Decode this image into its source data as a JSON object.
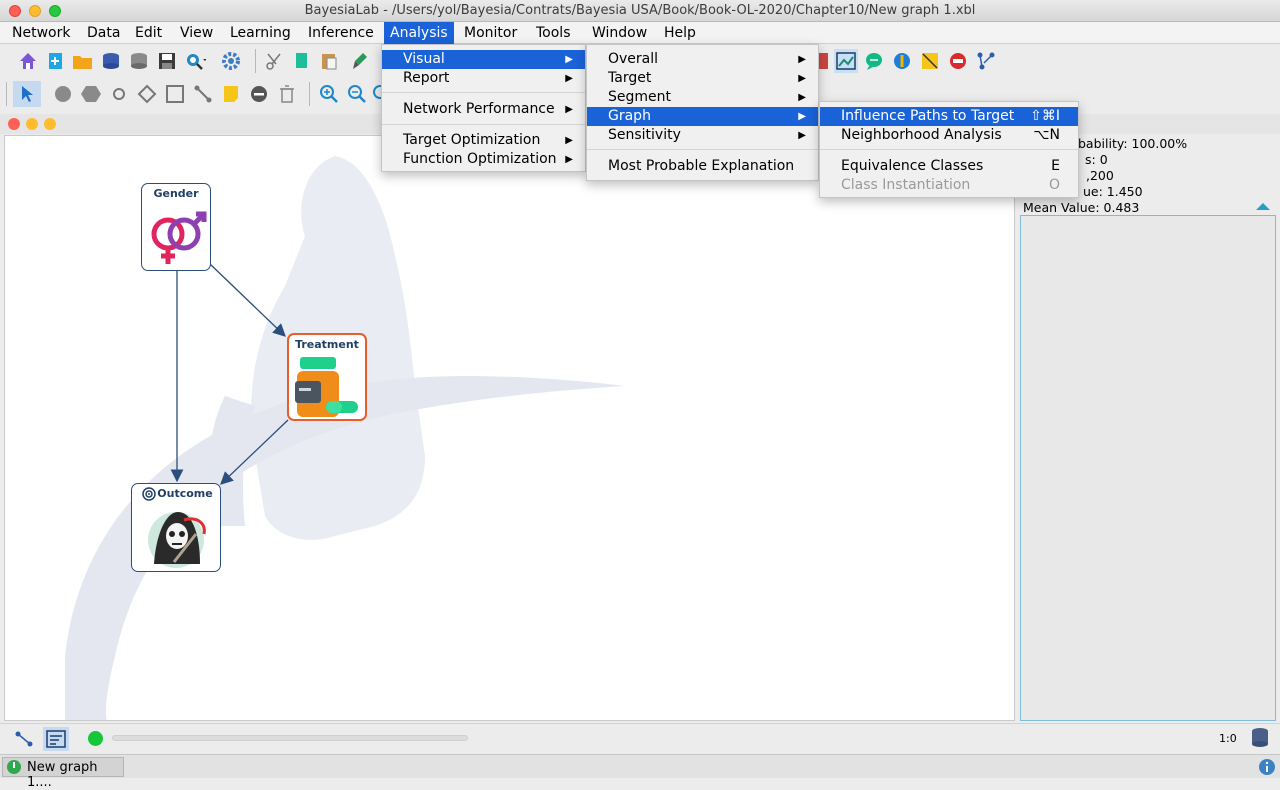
{
  "window": {
    "title": "BayesiaLab - /Users/yol/Bayesia/Contrats/Bayesia USA/Book/Book-OL-2020/Chapter10/New graph 1.xbl"
  },
  "menubar": [
    "Network",
    "Data",
    "Edit",
    "View",
    "Learning",
    "Inference",
    "Analysis",
    "Monitor",
    "Tools",
    "Window",
    "Help"
  ],
  "menus": {
    "analysis": {
      "visual": "Visual",
      "report": "Report",
      "network_performance": "Network Performance",
      "target_optimization": "Target Optimization",
      "function_optimization": "Function Optimization"
    },
    "visual": {
      "overall": "Overall",
      "target": "Target",
      "segment": "Segment",
      "graph": "Graph",
      "sensitivity": "Sensitivity",
      "mpe": "Most Probable Explanation"
    },
    "graph": {
      "influence_paths": "Influence Paths to Target",
      "influence_paths_shortcut": "⇧⌘I",
      "neighborhood": "Neighborhood Analysis",
      "neighborhood_shortcut": "⌥N",
      "equivalence": "Equivalence Classes",
      "equivalence_shortcut": "E",
      "class_instantiation": "Class Instantiation",
      "class_instantiation_shortcut": "O"
    }
  },
  "nodes": {
    "gender": "Gender",
    "treatment": "Treatment",
    "outcome": "Outcome"
  },
  "right_panel": {
    "line1": "bability: 100.00%",
    "line2": "s: 0",
    "line3": ",200",
    "line4": "ue: 1.450",
    "line5": "Mean Value: 0.483"
  },
  "statusbar": {
    "ratio": "1:0"
  },
  "taskbar": {
    "window_label": "New graph 1...."
  },
  "colors": {
    "accent": "#1a62d8",
    "node_border": "#2b4f7c",
    "arrow": "#2b4f7c"
  },
  "icons": [
    "home-icon",
    "new-network-icon",
    "open-folder-icon",
    "database-icon",
    "save-icon",
    "zoom-search-icon",
    "gear-icon",
    "scissors-icon",
    "copy-icon",
    "paste-icon",
    "brush-icon",
    "selection-arrow-icon",
    "circle-node-icon",
    "hexagon-node-icon",
    "small-node-icon",
    "diamond-node-icon",
    "square-node-icon",
    "arc-tool-icon",
    "note-icon",
    "minus-icon",
    "trash-icon",
    "zoom-in-icon",
    "zoom-out-icon",
    "chart-icon",
    "chat-icon",
    "info-globe-icon",
    "stop-icon",
    "graph-branch-icon"
  ]
}
